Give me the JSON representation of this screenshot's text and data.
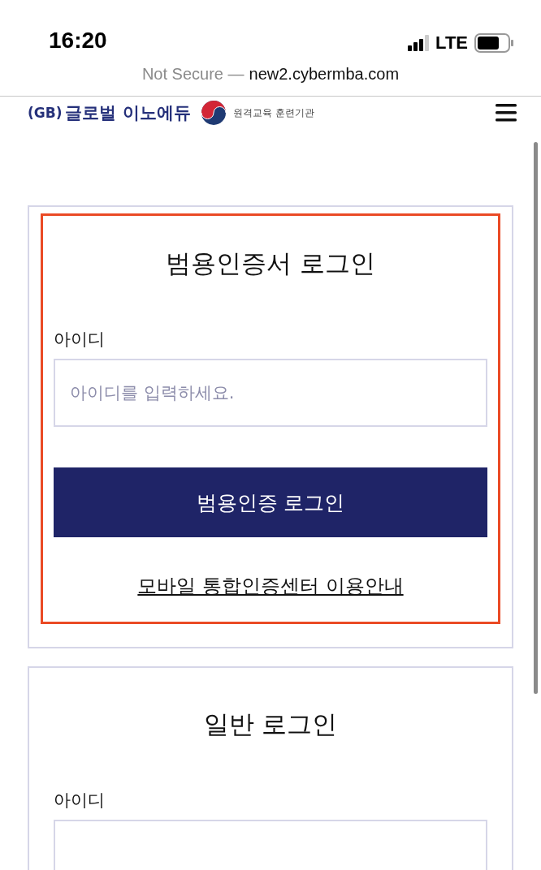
{
  "status_bar": {
    "time": "16:20",
    "network": "LTE"
  },
  "address_bar": {
    "security": "Not Secure —",
    "url": "new2.cybermba.com"
  },
  "header": {
    "logo_prefix": "(GB)",
    "logo_name": "글로벌 이노에듀",
    "badge_text": "원격교육 훈련기관"
  },
  "cards": [
    {
      "title": "범용인증서 로그인",
      "highlighted": true,
      "field_label": "아이디",
      "placeholder": "아이디를 입력하세요.",
      "button": "범용인증 로그인",
      "link": "모바일 통합인증센터 이용안내"
    },
    {
      "title": "일반 로그인",
      "highlighted": false,
      "field_label": "아이디"
    }
  ]
}
